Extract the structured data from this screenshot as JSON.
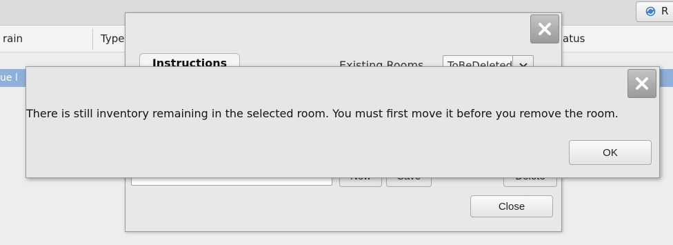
{
  "background": {
    "columns": [
      "rain",
      "Type",
      "atus"
    ],
    "selected_row_text": "ue l",
    "top_right_button_label": "R",
    "top_right_button_icon": "refresh-icon"
  },
  "room_dialog": {
    "close_icon": "close-icon",
    "tab_label": "Instructions",
    "existing_rooms_label": "Existing Rooms",
    "existing_rooms_value": "ToBeDeleted",
    "room_name_value": "",
    "buttons": {
      "new": "New",
      "save": "Save",
      "delete": "Delete",
      "close": "Close"
    }
  },
  "alert": {
    "close_icon": "close-icon",
    "message": "There is still inventory remaining in the selected room. You must first move it before you remove the room.",
    "ok_label": "OK"
  },
  "colors": {
    "selection": "#8fb0d8",
    "dialog_bg": "#e6e6e6"
  }
}
